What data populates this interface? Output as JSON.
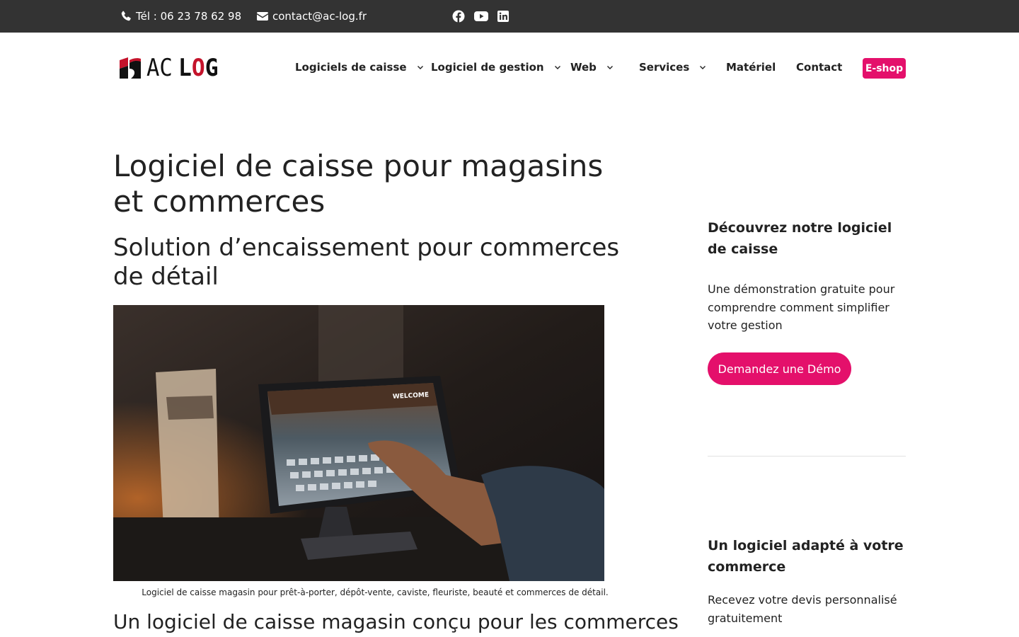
{
  "topbar": {
    "phone": "Tél : 06 23 78 62 98",
    "email": "contact@ac-log.fr",
    "social_icons": [
      "facebook-icon",
      "youtube-icon",
      "linkedin-icon"
    ]
  },
  "header": {
    "logo": {
      "part1": "AC",
      "part2_a": "L",
      "part2_b": "O",
      "part2_c": "G"
    },
    "nav": [
      {
        "label": "Logiciels de caisse",
        "has_dropdown": true
      },
      {
        "label": "Logiciel de gestion",
        "has_dropdown": true
      },
      {
        "label": "Web",
        "has_dropdown": true
      },
      {
        "label": "Services",
        "has_dropdown": true
      },
      {
        "label": "Matériel",
        "has_dropdown": false
      },
      {
        "label": "Contact",
        "has_dropdown": false
      }
    ],
    "eshop_label": "E-shop"
  },
  "main": {
    "title": "Logiciel de caisse pour magasins et commerces",
    "subtitle": "Solution d’encaissement pour commerces de détail",
    "hero_caption": "Logiciel de caisse magasin pour prêt-à-porter, dépôt-vente, caviste, fleuriste, beauté et commerces de détail.",
    "section_heading": "Un logiciel de caisse magasin conçu pour les commerces"
  },
  "sidebar": {
    "block1_title": "Découvrez notre logiciel de caisse",
    "block1_text": "Une démonstration gratuite pour comprendre comment simplifier votre gestion",
    "demo_button": "Demandez une Démo",
    "block2_title": "Un logiciel adapté à votre commerce",
    "block2_text": "Recevez votre devis personnalisé gratuitement"
  },
  "colors": {
    "topbar_bg": "#333333",
    "accent": "#e4106b",
    "logo_red": "#c4132b"
  }
}
